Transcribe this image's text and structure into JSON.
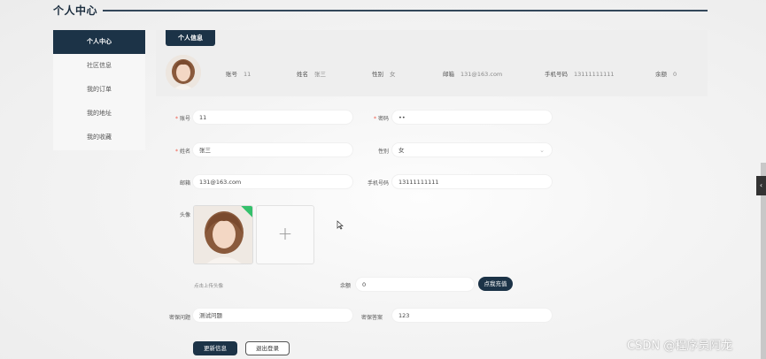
{
  "header": {
    "title": "个人中心"
  },
  "sidebar": {
    "items": [
      {
        "label": "个人中心",
        "active": true
      },
      {
        "label": "社区信息"
      },
      {
        "label": "我的订单"
      },
      {
        "label": "我的地址"
      },
      {
        "label": "我的收藏"
      }
    ]
  },
  "info_card": {
    "tab_label": "个人信息",
    "fields": [
      {
        "label": "账号",
        "value": "11"
      },
      {
        "label": "姓名",
        "value": "张三"
      },
      {
        "label": "性别",
        "value": "女"
      },
      {
        "label": "邮箱",
        "value": "131@163.com"
      },
      {
        "label": "手机号码",
        "value": "13111111111"
      },
      {
        "label": "余额",
        "value": "0"
      }
    ]
  },
  "form": {
    "account": {
      "label": "账号",
      "value": "11"
    },
    "password": {
      "label": "密码",
      "value": "••"
    },
    "name": {
      "label": "姓名",
      "value": "张三"
    },
    "gender": {
      "label": "性别",
      "value": "女"
    },
    "email": {
      "label": "邮箱",
      "value": "131@163.com"
    },
    "phone": {
      "label": "手机号码",
      "value": "13111111111"
    },
    "avatar": {
      "label": "头像",
      "hint": "点击上传头像"
    },
    "balance": {
      "label": "余额",
      "value": "0",
      "recharge_label": "点我充值"
    },
    "security_question": {
      "label": "密保问题",
      "value": "测试问题"
    },
    "security_answer": {
      "label": "密保答案",
      "value": "123"
    },
    "update_label": "更新信息",
    "logout_label": "退出登录"
  },
  "watermark": "CSDN @程序员阿龙",
  "colors": {
    "primary": "#1c3347",
    "badge": "#34c06b",
    "required": "#ee5544"
  }
}
